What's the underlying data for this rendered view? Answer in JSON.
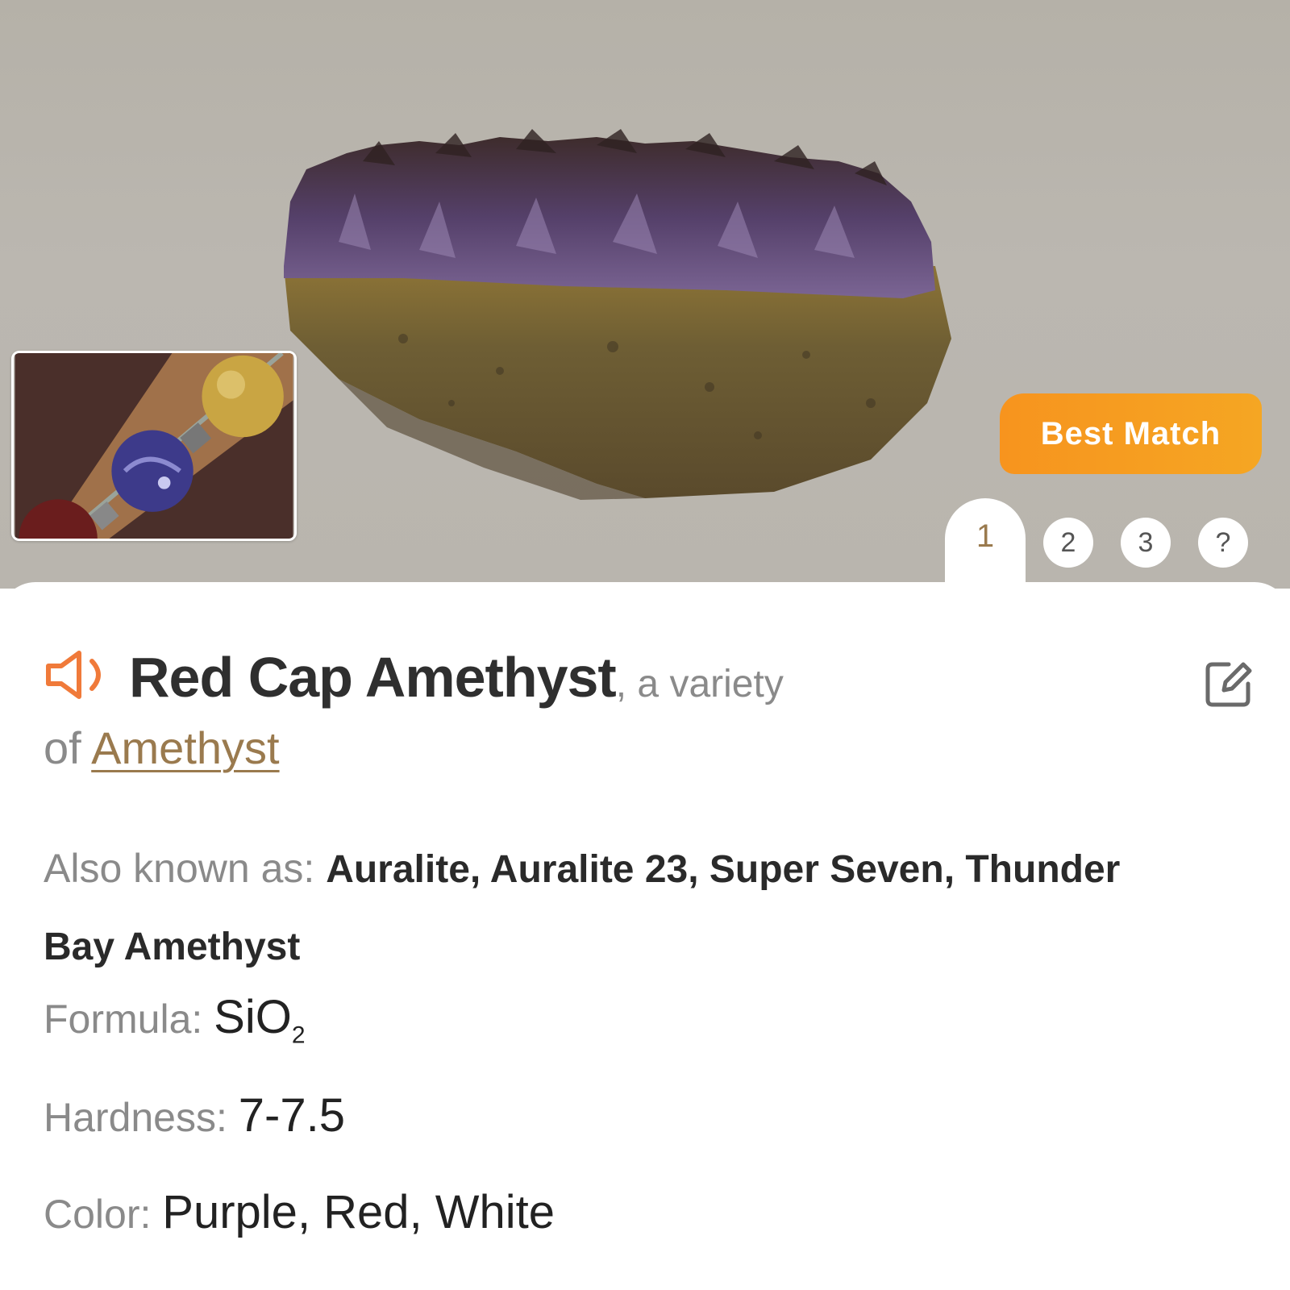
{
  "hero": {
    "badge": "Best Match",
    "tabs": [
      "1",
      "2",
      "3",
      "?"
    ]
  },
  "mineral": {
    "name": "Red Cap Amethyst",
    "variety_prefix": ", a variety",
    "variety_of": "of",
    "parent": "Amethyst",
    "aka_label": "Also known as:",
    "aka_value": "Auralite, Auralite 23, Super Seven, Thunder Bay Amethyst",
    "formula_label": "Formula:",
    "formula_base": "SiO",
    "formula_sub": "2",
    "hardness_label": "Hardness:",
    "hardness_value": "7-7.5",
    "color_label": "Color:",
    "color_value": "Purple, Red, White"
  },
  "colors": {
    "accent": "#f7941e",
    "link": "#9a7a4e",
    "speaker": "#f07a3a"
  },
  "icons": {
    "speaker": "speaker-icon",
    "edit": "edit-icon"
  }
}
